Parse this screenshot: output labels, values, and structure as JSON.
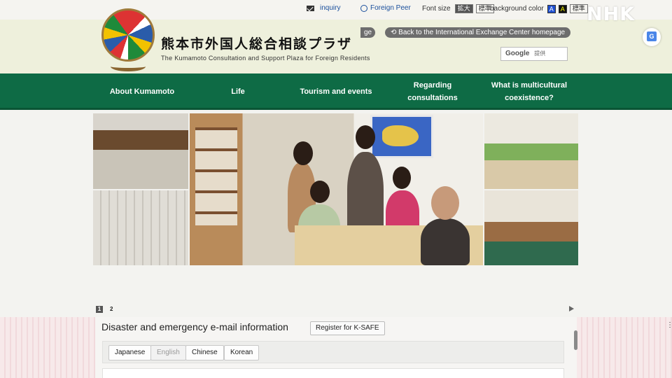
{
  "utility_bar": {
    "inquiry_label": "inquiry",
    "foreign_peer_label": "Foreign Peer",
    "font_size_label": "Font size",
    "font_size_large": "拡大",
    "font_size_standard": "標準",
    "bg_color_label": "background color",
    "bg_color_blue": "A",
    "bg_color_black": "A",
    "bg_color_standard": "標準"
  },
  "header": {
    "title_ja": "熊本市外国人総合相談プラザ",
    "subtitle_en": "The Kumamoto Consultation and Support Plaza for Foreign Residents",
    "hidden_pill_tail": "ge",
    "back_link_label": "Back to the International Exchange Center homepage",
    "search_brand": "Google",
    "search_suffix": "提供"
  },
  "nav": {
    "items": [
      "About Kumamoto",
      "Life",
      "Tourism and events",
      "Regarding consultations",
      "What is multicultural coexistence?"
    ]
  },
  "slider": {
    "pages": [
      "1",
      "2"
    ],
    "current_page": 1
  },
  "emergency_panel": {
    "title": "Disaster and emergency e-mail information",
    "register_button": "Register for K-SAFE",
    "languages": [
      "Japanese",
      "English",
      "Chinese",
      "Korean"
    ],
    "selected_language": "English"
  },
  "overlay": {
    "watermark": "NHK"
  },
  "colors": {
    "nav_green": "#0e6b45",
    "header_bg": "#eef0dc",
    "link_blue": "#1a4f9c",
    "stripe_pink": "#f1d9dc"
  }
}
